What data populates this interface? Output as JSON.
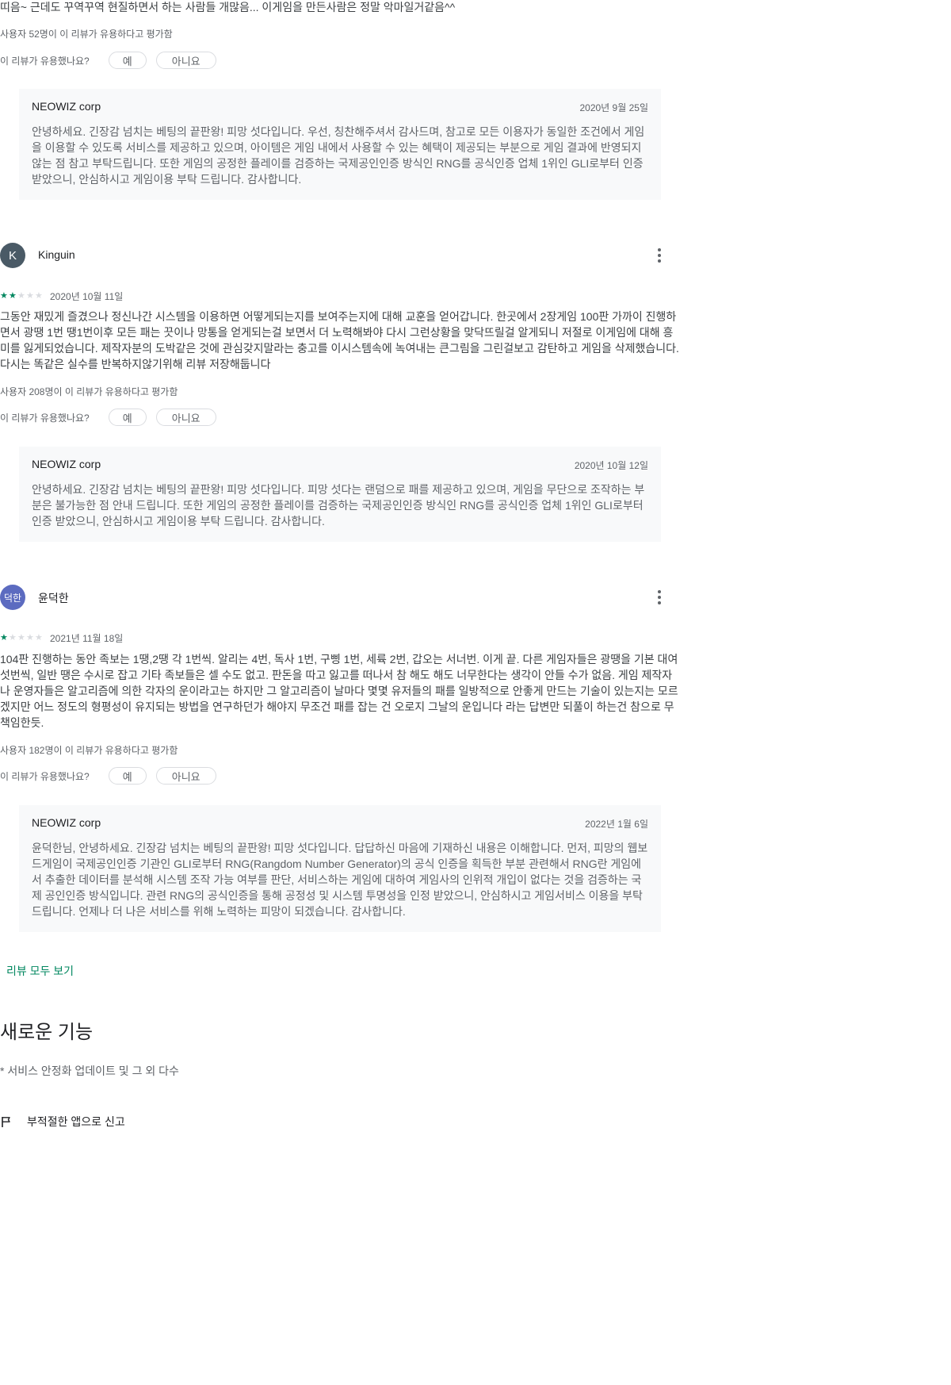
{
  "top_review": {
    "text_tail": "띠음~ 근데도 꾸역꾸역 현질하면서 하는 사람들 개많음... 이게임을 만든사람은 정말 악마일거같음^^",
    "helpful_count": "사용자 52명이 이 리뷰가 유용하다고 평가함",
    "helpful_question": "이 리뷰가 유용했나요?",
    "yes_label": "예",
    "no_label": "아니요",
    "reply": {
      "author": "NEOWIZ corp",
      "date": "2020년 9월 25일",
      "body": "안녕하세요. 긴장감 넘치는 베팅의 끝판왕! 피망 섯다입니다. 우선, 칭찬해주셔서 감사드며, 참고로 모든 이용자가 동일한 조건에서 게임을 이용할 수 있도록 서비스를 제공하고 있으며, 아이템은 게임 내에서 사용할 수 있는 혜택이 제공되는 부분으로 게임 결과에 반영되지 않는 점 참고 부탁드립니다. 또한 게임의 공정한 플레이를 검증하는 국제공인인증 방식인 RNG를 공식인증 업체 1위인 GLI로부터 인증 받았으니, 안심하시고 게임이용 부탁 드립니다. 감사합니다."
    }
  },
  "reviews": [
    {
      "avatar_letter": "K",
      "avatar_color": "#4a5a66",
      "name": "Kinguin",
      "rating": 2,
      "date": "2020년 10월 11일",
      "body": "그동안 재밌게 즐겼으나 정신나간 시스템을 이용하면 어떻게되는지를 보여주는지에 대해 교훈을 얻어갑니다. 한곳에서 2장게임 100판 가까이 진행하면서 광땡 1번 땡1번이후 모든 패는 끗이나 망통을 얻게되는걸 보면서 더 노력해봐야 다시 그런상황을 맞닥뜨릴걸 알게되니 저절로 이게임에 대해 흥미를 잃게되었습니다. 제작자분의 도박같은 것에 관심갖지말라는 충고를 이시스템속에 녹여내는 큰그림을 그린걸보고 감탄하고 게임을 삭제했습니다. 다시는 똑같은 실수를 반복하지않기위해 리뷰 저장해둡니다",
      "helpful_count": "사용자 208명이 이 리뷰가 유용하다고 평가함",
      "helpful_question": "이 리뷰가 유용했나요?",
      "yes_label": "예",
      "no_label": "아니요",
      "reply": {
        "author": "NEOWIZ corp",
        "date": "2020년 10월 12일",
        "body": "안녕하세요. 긴장감 넘치는 베팅의 끝판왕! 피망 섯다입니다. 피망 섯다는 랜덤으로 패를 제공하고 있으며, 게임을 무단으로 조작하는 부분은 불가능한 점 안내 드립니다. 또한 게임의 공정한 플레이를 검증하는 국제공인인증 방식인 RNG를 공식인증 업체 1위인 GLI로부터 인증 받았으니, 안심하시고 게임이용 부탁 드립니다. 감사합니다."
      }
    },
    {
      "avatar_letter": "덕한",
      "avatar_color": "#5c6bc0",
      "name": "윤덕한",
      "rating": 1,
      "date": "2021년 11월 18일",
      "body": "104판 진행하는 동안 족보는 1땡,2땡 각 1번씩. 알리는 4번, 독사 1번, 구삥 1번, 세륙 2번, 갑오는 서너번. 이게 끝. 다른 게임자들은 광땡을 기본 대여섯번씩, 일반 땡은 수시로 잡고 기타 족보들은 셀 수도 없고. 판돈을 따고 잃고를 떠나서 참 해도 해도 너무한다는 생각이 안들 수가 없음. 게임 제작자나 운영자들은 알고리즘에 의한 각자의 운이라고는 하지만 그 알고리즘이 날마다 몇몇 유저들의 패를 일방적으로 안좋게 만드는 기술이 있는지는 모르겠지만 어느 정도의 형평성이 유지되는 방법을 연구하던가 해야지 무조건 패를 잡는 건 오로지 그날의 운입니다 라는 답변만 되풀이 하는건 참으로 무책임한듯.",
      "helpful_count": "사용자 182명이 이 리뷰가 유용하다고 평가함",
      "helpful_question": "이 리뷰가 유용했나요?",
      "yes_label": "예",
      "no_label": "아니요",
      "reply": {
        "author": "NEOWIZ corp",
        "date": "2022년 1월 6일",
        "body": "윤덕한님, 안녕하세요. 긴장감 넘치는 베팅의 끝판왕! 피망 섯다입니다. 답답하신 마음에 기재하신 내용은 이해합니다. 먼저, 피망의 웹보드게임이 국제공인인증 기관인 GLI로부터 RNG(Rangdom Number Generator)의 공식 인증을 획득한 부분 관련해서 RNG란 게임에서 추출한 데이터를 분석해 시스템 조작 가능 여부를 판단, 서비스하는 게임에 대하여 게임사의 인위적 개입이 없다는 것을 검증하는 국제 공인인증 방식입니다. 관련 RNG의 공식인증을 통해 공정성 및 시스템 투명성을 인정 받았으니, 안심하시고 게임서비스 이용을 부탁 드립니다. 언제나 더 나은 서비스를 위해 노력하는 피망이 되겠습니다. 감사합니다."
      }
    }
  ],
  "see_all_reviews": "리뷰 모두 보기",
  "whats_new": {
    "title": "새로운 기능",
    "body": "* 서비스 안정화 업데이트 및 그 외 다수"
  },
  "report": {
    "icon": "flag-icon",
    "label": "부적절한 앱으로 신고"
  },
  "colors": {
    "accent": "#01875f",
    "reply_bg": "#f8f9fa"
  }
}
